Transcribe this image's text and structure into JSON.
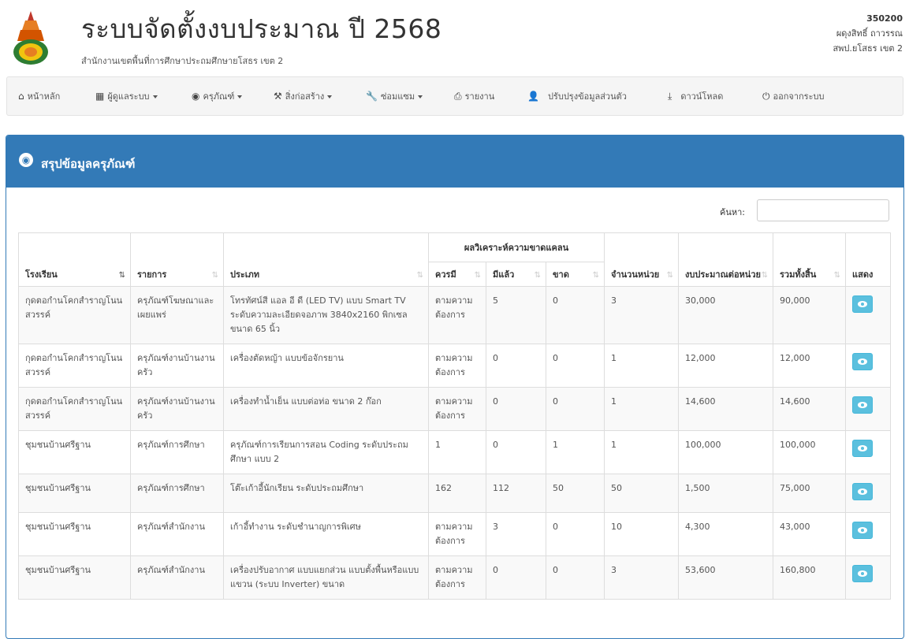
{
  "header": {
    "title": "ระบบจัดตั้งงบประมาณ ปี 2568",
    "subtitle": "สำนักงานเขตพื้นที่การศึกษาประถมศึกษายโสธร เขต 2",
    "user_id": "350200",
    "user_name": "ผดุงสิทธิ์ ถาวรรณ",
    "user_org": "สพป.ยโสธร เขต 2"
  },
  "nav": {
    "home": "หน้าหลัก",
    "admin": "ผู้ดูแลระบบ",
    "equipment": "ครุภัณฑ์",
    "construction": "สิ่งก่อสร้าง",
    "repair": "ซ่อมแซม",
    "report": "รายงาน",
    "profile": "ปรับปรุงข้อมูลส่วนตัว",
    "download": "ดาวน์โหลด",
    "logout": "ออกจากระบบ"
  },
  "panel": {
    "title": "สรุปข้อมูลครุภัณฑ์"
  },
  "search": {
    "label": "ค้นหา:",
    "value": ""
  },
  "table": {
    "group_header": "ผลวิเคราะห์ความขาดแคลน",
    "headers": {
      "school": "โรงเรียน",
      "item": "รายการ",
      "type": "ประเภท",
      "should_have": "ควรมี",
      "have": "มีแล้ว",
      "lack": "ขาด",
      "units": "จำนวนหน่วย",
      "budget_per_unit": "งบประมาณต่อหน่วย",
      "total": "รวมทั้งสิ้น",
      "show": "แสดง"
    },
    "rows": [
      {
        "school": "กุดตอกำนโคกสำราญโนนสวรรค์",
        "item": "ครุภัณฑ์โฆษณาและเผยแพร่",
        "type": "โทรทัศน์สี แอล อี ดี (LED TV) แบบ Smart TV ระดับความละเอียดจอภาพ 3840x2160 พิกเซล ขนาด 65 นิ้ว",
        "should": "ตามความต้องการ",
        "have": "5",
        "lack": "0",
        "units": "3",
        "per_unit": "30,000",
        "total": "90,000"
      },
      {
        "school": "กุดตอกำนโคกสำราญโนนสวรรค์",
        "item": "ครุภัณฑ์งานบ้านงานครัว",
        "type": "เครื่องตัดหญ้า แบบข้อจักรยาน",
        "should": "ตามความต้องการ",
        "have": "0",
        "lack": "0",
        "units": "1",
        "per_unit": "12,000",
        "total": "12,000"
      },
      {
        "school": "กุดตอกำนโคกสำราญโนนสวรรค์",
        "item": "ครุภัณฑ์งานบ้านงานครัว",
        "type": "เครื่องทำน้ำเย็น แบบต่อท่อ ขนาด 2 ก๊อก",
        "should": "ตามความต้องการ",
        "have": "0",
        "lack": "0",
        "units": "1",
        "per_unit": "14,600",
        "total": "14,600"
      },
      {
        "school": "ชุมชนบ้านศรีฐาน",
        "item": "ครุภัณฑ์การศึกษา",
        "type": "ครุภัณฑ์การเรียนการสอน Coding ระดับประถมศึกษา แบบ 2",
        "should": "1",
        "have": "0",
        "lack": "1",
        "units": "1",
        "per_unit": "100,000",
        "total": "100,000"
      },
      {
        "school": "ชุมชนบ้านศรีฐาน",
        "item": "ครุภัณฑ์การศึกษา",
        "type": "โต๊ะเก้าอี้นักเรียน ระดับประถมศึกษา",
        "should": "162",
        "have": "112",
        "lack": "50",
        "units": "50",
        "per_unit": "1,500",
        "total": "75,000"
      },
      {
        "school": "ชุมชนบ้านศรีฐาน",
        "item": "ครุภัณฑ์สำนักงาน",
        "type": "เก้าอี้ทำงาน ระดับชำนาญการพิเศษ",
        "should": "ตามความต้องการ",
        "have": "3",
        "lack": "0",
        "units": "10",
        "per_unit": "4,300",
        "total": "43,000"
      },
      {
        "school": "ชุมชนบ้านศรีฐาน",
        "item": "ครุภัณฑ์สำนักงาน",
        "type": "เครื่องปรับอากาศ แบบแยกส่วน แบบตั้งพื้นหรือแบบแขวน (ระบบ Inverter) ขนาด",
        "should": "ตามความต้องการ",
        "have": "0",
        "lack": "0",
        "units": "3",
        "per_unit": "53,600",
        "total": "160,800"
      }
    ]
  },
  "colors": {
    "primary": "#337ab7",
    "info": "#5bc0de"
  }
}
